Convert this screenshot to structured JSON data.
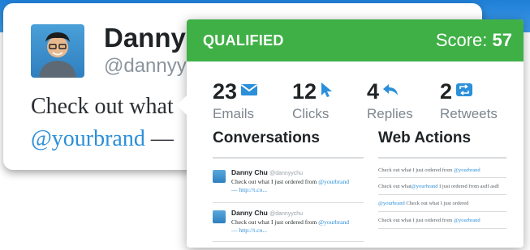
{
  "tweet": {
    "name": "Danny",
    "handle": "@dannyyc",
    "text_start": "Check out what",
    "mention": "@yourbrand",
    "text_tail": " —",
    "avatar_icon": "user-avatar"
  },
  "popup": {
    "status": "QUALIFIED",
    "score_label": "Score: ",
    "score_value": "57",
    "header_color": "#3fb046",
    "stats": [
      {
        "value": "23",
        "label": "Emails",
        "icon": "envelope-icon"
      },
      {
        "value": "12",
        "label": "Clicks",
        "icon": "cursor-icon"
      },
      {
        "value": "4",
        "label": "Replies",
        "icon": "reply-icon"
      },
      {
        "value": "2",
        "label": "Retweets",
        "icon": "retweet-icon"
      }
    ],
    "conversations": {
      "title": "Conversations",
      "items": [
        {
          "name": "Danny Chu",
          "handle": "@dannyychu",
          "text": "Check out what I just ordered from ",
          "mention": "@yourbrand",
          "link": "— http://t.co..."
        },
        {
          "name": "Danny Chu",
          "handle": "@dannyychu",
          "text": "Check out what I just ordered from ",
          "mention": "@yourbrand",
          "link": "— http://t.co..."
        }
      ]
    },
    "web_actions": {
      "title": "Web Actions",
      "items": [
        {
          "pre": "Check out what I just ordered from ",
          "mention": "@yourbrand",
          "post": ""
        },
        {
          "pre": "Check out what",
          "mention": "@yourbrand",
          "post": " I just ordered from asdf asdf"
        },
        {
          "pre": "",
          "mention": "@yourbrand",
          "post": " Check out what I just ordered"
        },
        {
          "pre": "Check out what I just ordered from ",
          "mention": "@yourbrand",
          "post": ""
        }
      ]
    }
  },
  "colors": {
    "accent": "#2b8fd9",
    "brand_blue": "#1f7fd6",
    "qualified_green": "#3fb046"
  }
}
